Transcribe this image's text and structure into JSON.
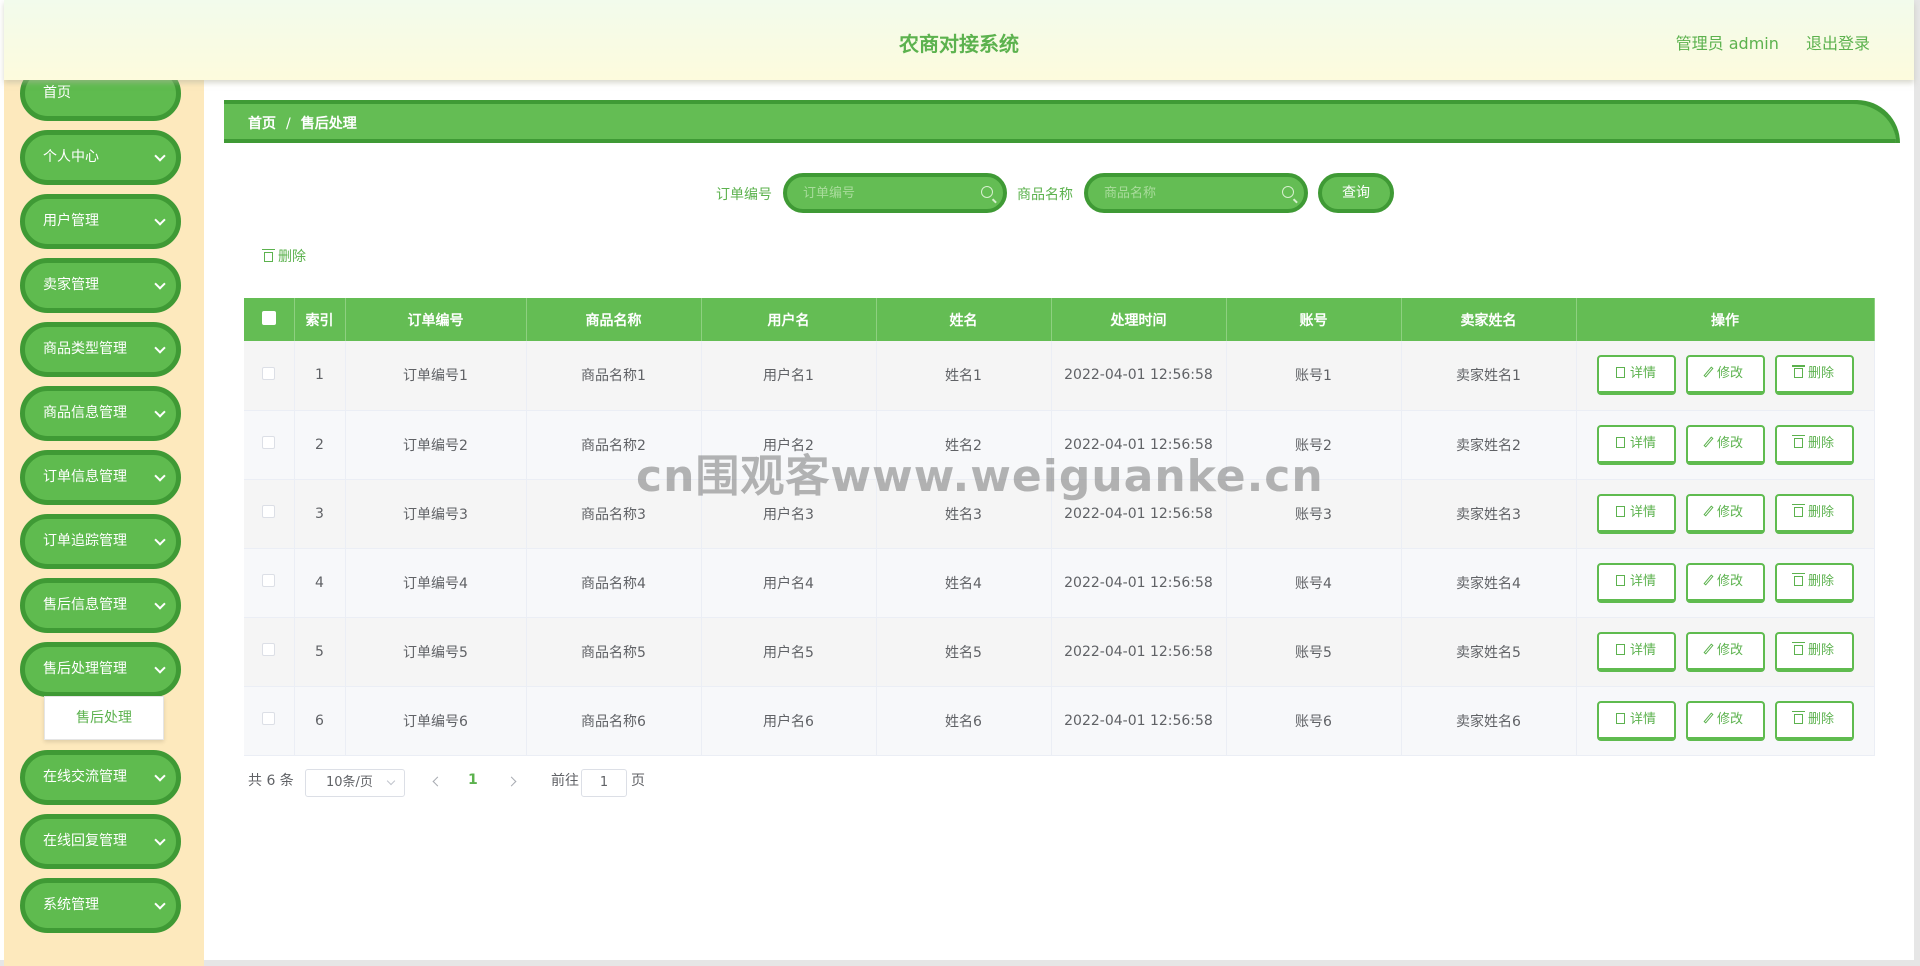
{
  "header": {
    "title": "农商对接系统",
    "admin_label": "管理员 admin",
    "logout_label": "退出登录"
  },
  "sidebar": {
    "items": [
      {
        "label": "首页"
      },
      {
        "label": "个人中心"
      },
      {
        "label": "用户管理"
      },
      {
        "label": "卖家管理"
      },
      {
        "label": "商品类型管理"
      },
      {
        "label": "商品信息管理"
      },
      {
        "label": "订单信息管理"
      },
      {
        "label": "订单追踪管理"
      },
      {
        "label": "售后信息管理"
      },
      {
        "label": "售后处理管理"
      },
      {
        "label": "在线交流管理"
      },
      {
        "label": "在线回复管理"
      },
      {
        "label": "系统管理"
      }
    ],
    "sub_item": "售后处理"
  },
  "breadcrumb": {
    "home": "首页",
    "separator": "/",
    "current": "售后处理"
  },
  "search": {
    "order_label": "订单编号",
    "order_placeholder": "订单编号",
    "product_label": "商品名称",
    "product_placeholder": "商品名称",
    "query_button": "查询"
  },
  "toolbar": {
    "delete_label": "删除"
  },
  "table": {
    "headers": [
      "索引",
      "订单编号",
      "商品名称",
      "用户名",
      "姓名",
      "处理时间",
      "账号",
      "卖家姓名",
      "操作"
    ],
    "rows": [
      [
        "1",
        "订单编号1",
        "商品名称1",
        "用户名1",
        "姓名1",
        "2022-04-01 12:56:58",
        "账号1",
        "卖家姓名1"
      ],
      [
        "2",
        "订单编号2",
        "商品名称2",
        "用户名2",
        "姓名2",
        "2022-04-01 12:56:58",
        "账号2",
        "卖家姓名2"
      ],
      [
        "3",
        "订单编号3",
        "商品名称3",
        "用户名3",
        "姓名3",
        "2022-04-01 12:56:58",
        "账号3",
        "卖家姓名3"
      ],
      [
        "4",
        "订单编号4",
        "商品名称4",
        "用户名4",
        "姓名4",
        "2022-04-01 12:56:58",
        "账号4",
        "卖家姓名4"
      ],
      [
        "5",
        "订单编号5",
        "商品名称5",
        "用户名5",
        "姓名5",
        "2022-04-01 12:56:58",
        "账号5",
        "卖家姓名5"
      ],
      [
        "6",
        "订单编号6",
        "商品名称6",
        "用户名6",
        "姓名6",
        "2022-04-01 12:56:58",
        "账号6",
        "卖家姓名6"
      ]
    ],
    "actions": {
      "detail": "详情",
      "edit": "修改",
      "delete": "删除"
    }
  },
  "pagination": {
    "total": "共 6 条",
    "page_size": "10条/页",
    "current_page": "1",
    "goto_label": "前往",
    "goto_value": "1",
    "page_suffix": "页"
  },
  "watermark": "cn围观客www.weiguanke.cn",
  "colors": {
    "accent": "#64bd54",
    "accent_dark": "#3f9a35",
    "sidebar_bg": "#fde9bd"
  }
}
